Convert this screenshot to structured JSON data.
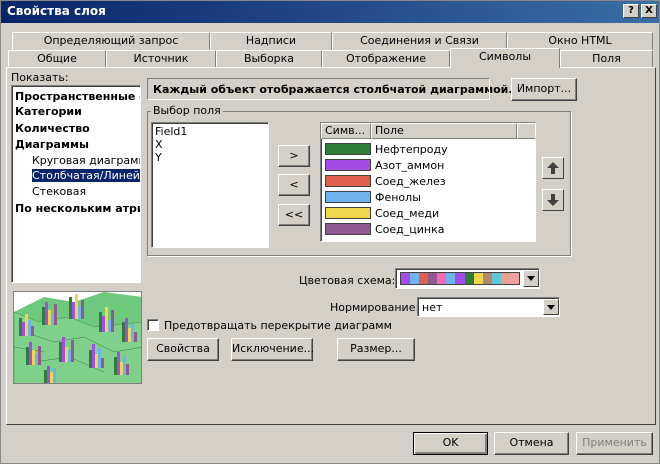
{
  "window": {
    "title": "Свойства слоя",
    "help_btn": "?",
    "close_btn": "X"
  },
  "tabs_back": [
    "Определяющий запрос",
    "Надписи",
    "Соединения и Связи",
    "Окно HTML"
  ],
  "tabs_front": [
    "Общие",
    "Источник",
    "Выборка",
    "Отображение",
    "Символы",
    "Поля"
  ],
  "active_tab": "Символы",
  "show": {
    "label": "Показать:",
    "items": [
      {
        "label": "Пространственные объекты",
        "level": 0,
        "bold": true
      },
      {
        "label": "Категории",
        "level": 0,
        "bold": true
      },
      {
        "label": "Количество",
        "level": 0,
        "bold": true
      },
      {
        "label": "Диаграммы",
        "level": 0,
        "bold": true
      },
      {
        "label": "Круговая диаграмма",
        "level": 1,
        "bold": false
      },
      {
        "label": "Столбчатая/Линейчатая",
        "level": 1,
        "bold": false,
        "selected": true
      },
      {
        "label": "Стековая",
        "level": 1,
        "bold": false
      },
      {
        "label": "По нескольким атрибутам",
        "level": 0,
        "bold": true
      }
    ]
  },
  "description": "Каждый объект отображается столбчатой диаграммой.",
  "import_btn": "Импорт...",
  "field_select": {
    "label": "Выбор поля",
    "available": [
      "Field1",
      "X",
      "Y"
    ],
    "btn_add": ">",
    "btn_remove": "<",
    "btn_remove_all": "<<",
    "col_symbol": "Симв...",
    "col_field": "Поле",
    "rows": [
      {
        "color": "#2E7D3A",
        "label": "Нефтепроду"
      },
      {
        "color": "#A64CE6",
        "label": "Азот_аммон"
      },
      {
        "color": "#E0604F",
        "label": "Соед_желез"
      },
      {
        "color": "#6DB3F0",
        "label": "Фенолы"
      },
      {
        "color": "#F0D64A",
        "label": "Соед_меди"
      },
      {
        "color": "#8E5A90",
        "label": "Соед_цинка"
      }
    ]
  },
  "color_scheme": {
    "label": "Цветовая схема:",
    "colors": [
      "#A64CE6",
      "#6DB3F0",
      "#E0604F",
      "#8E5A90",
      "#F06BB0",
      "#6DB3F0",
      "#A64CE6",
      "#2E7D3A",
      "#F0D64A",
      "#B08A6A",
      "#5CC8D8",
      "#E8A090",
      "#F0A0A0"
    ]
  },
  "normalization": {
    "label": "Нормирование:",
    "value": "нет"
  },
  "prevent_overlap": {
    "label": "Предотвращать перекрытие диаграмм",
    "checked": false
  },
  "buttons": {
    "properties": "Свойства",
    "exclusion": "Исключение...",
    "size": "Размер...",
    "ok": "OK",
    "cancel": "Отмена",
    "apply": "Применить"
  }
}
